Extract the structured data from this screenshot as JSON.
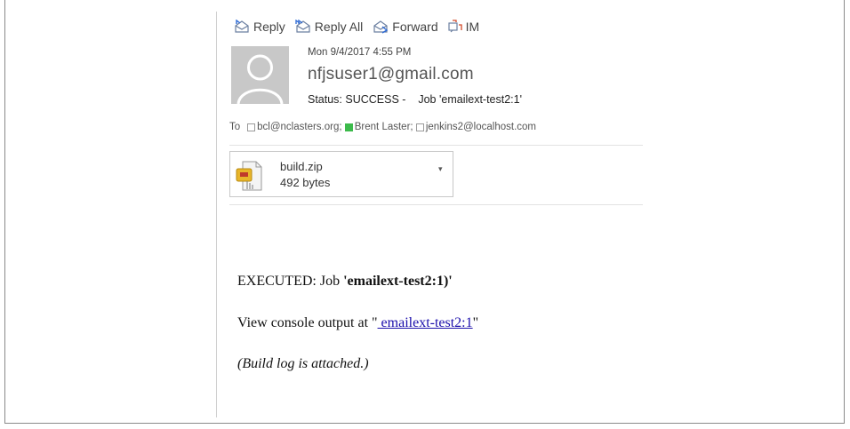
{
  "toolbar": {
    "reply": "Reply",
    "reply_all": "Reply All",
    "forward": "Forward",
    "im": "IM"
  },
  "message": {
    "date": "Mon 9/4/2017 4:55 PM",
    "sender": "nfjsuser1@gmail.com",
    "subject_status": "Status: SUCCESS -",
    "subject_job": "Job 'emailext-test2:1'",
    "to_label": "To",
    "recipients": [
      {
        "label": "bcl@nclasters.org;",
        "marker": "empty"
      },
      {
        "label": "Brent Laster;",
        "marker": "green"
      },
      {
        "label": "jenkins2@localhost.com",
        "marker": "empty"
      }
    ]
  },
  "attachment": {
    "name": "build.zip",
    "size": "492 bytes"
  },
  "body": {
    "executed_prefix": "EXECUTED: Job ",
    "executed_job": "'emailext-test2:1)'",
    "console_prefix": "View console output at \"",
    "console_link": " emailext-test2:1",
    "console_suffix": "\"",
    "build_log": "(Build log is attached.)"
  },
  "colors": {
    "presence_green": "#3cba4b",
    "link": "#1a0dab"
  }
}
